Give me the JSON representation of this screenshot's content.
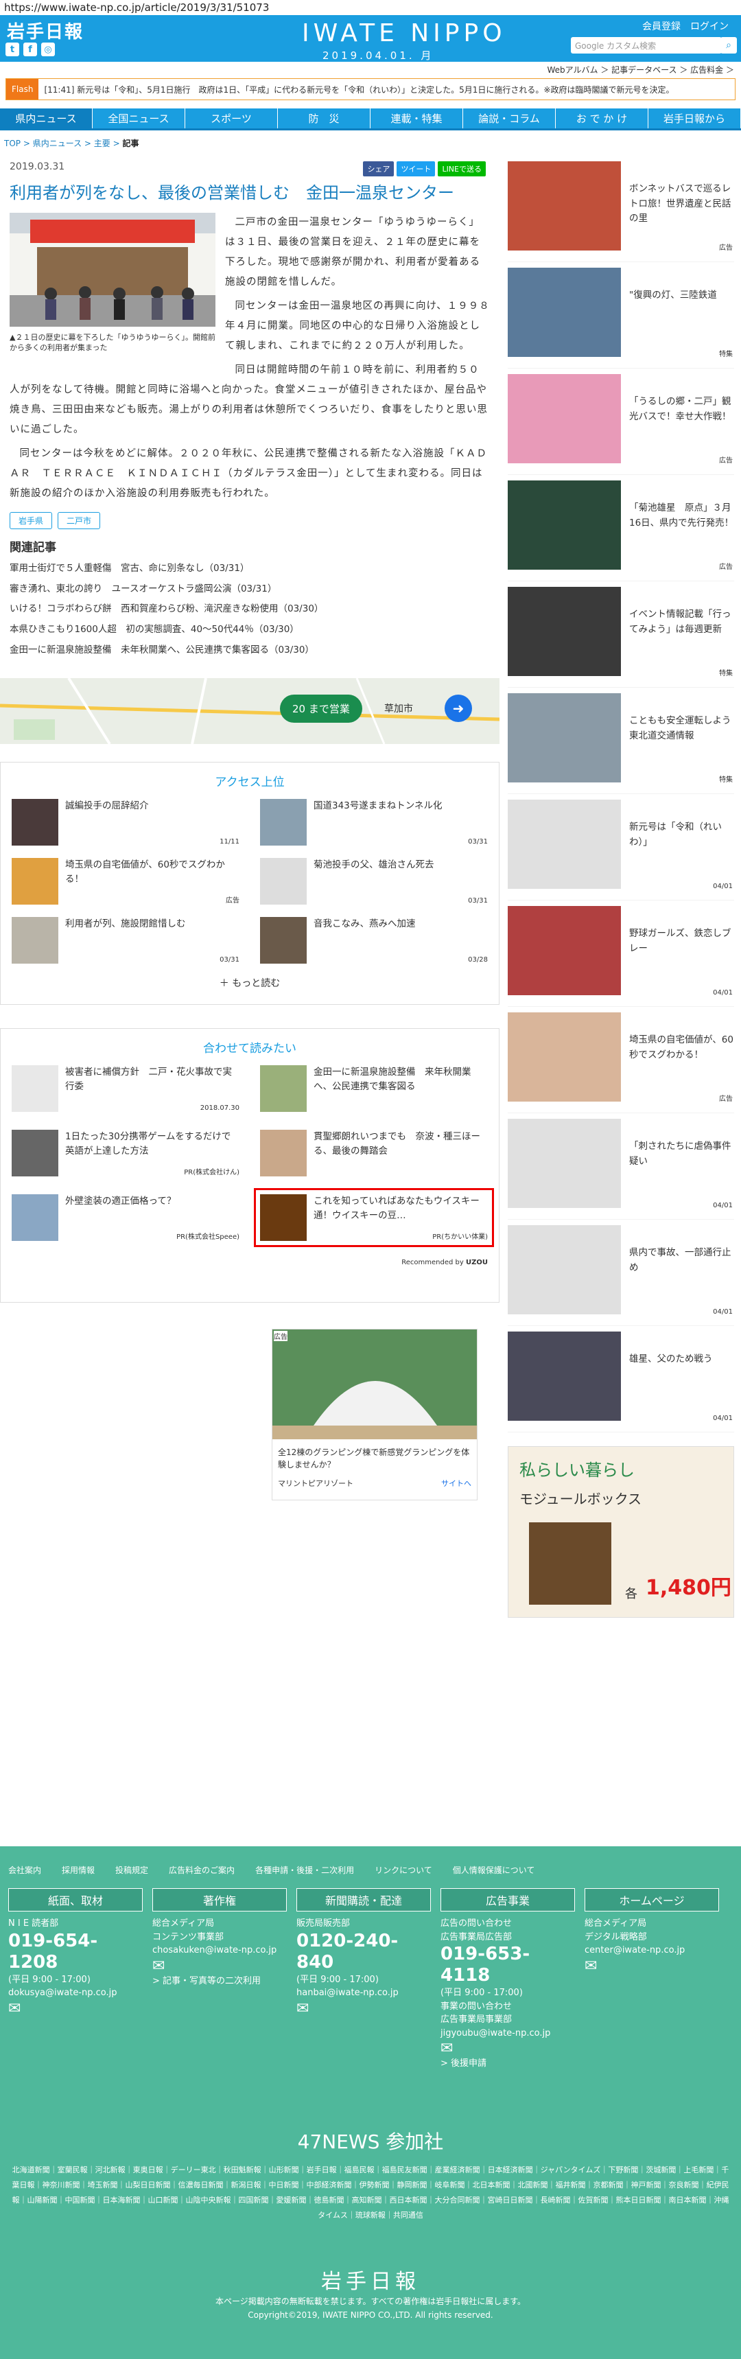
{
  "url": "https://www.iwate-np.co.jp/article/2019/3/31/51073",
  "header": {
    "logo": "岩手日報",
    "brand": "IWATE NIPPO",
    "date": "2019.04.01. 月",
    "register": "会員登録",
    "login": "ログイン",
    "search_placeholder": "Google カスタム検索"
  },
  "subnav": "Webアルバム ＞ 記事データベース ＞ 広告料金 ＞",
  "flash": {
    "label": "Flash",
    "text": "[11:41] 新元号は「令和」、5月1日施行　政府は1日、「平成」に代わる新元号を「令和（れいわ）」と決定した。5月1日に施行される。※政府は臨時閣議で新元号を決定。"
  },
  "nav": [
    "県内ニュース",
    "全国ニュース",
    "スポーツ",
    "防　災",
    "連載・特集",
    "論説・コラム",
    "お で か け",
    "岩手日報から"
  ],
  "crumb": {
    "a": "TOP",
    "b": "県内ニュース",
    "c": "主要",
    "d": "記事"
  },
  "article": {
    "date": "2019.03.31",
    "title": "利用者が列をなし、最後の営業惜しむ　金田一温泉センター",
    "share": [
      "シェア",
      "ツイート",
      "LINEで送る"
    ],
    "caption": "▲２１日の歴史に幕を下ろした「ゆうゆうゆーらく」。開館前から多くの利用者が集まった",
    "p1": "二戸市の金田一温泉センター「ゆうゆうゆーらく」は３１日、最後の営業日を迎え、２１年の歴史に幕を下ろした。現地で感謝祭が開かれ、利用者が愛着ある施設の閉館を惜しんだ。",
    "p2": "同センターは金田一温泉地区の再興に向け、１９９８年４月に開業。同地区の中心的な日帰り入浴施設として親しまれ、これまでに約２２０万人が利用した。",
    "p3": "同日は開館時間の午前１０時を前に、利用者約５０人が列をなして待機。開館と同時に浴場へと向かった。食堂メニューが値引きされたほか、屋台品や焼き鳥、三田田由来なども販売。湯上がりの利用者は休憩所でくつろいだり、食事をしたりと思い思いに過ごした。",
    "p4": "同センターは今秋をめどに解体。２０２０年秋に、公民連携で整備される新たな入浴施設「ＫＡＤＡＲ　ＴＥＲＲＡＣＥ　ＫＩＮＤＡＩＣＨＩ（カダルテラス金田一）」として生まれ変わる。同日は新施設の紹介のほか入浴施設の利用券販売も行われた。",
    "tags": [
      "岩手県",
      "二戸市"
    ],
    "related_title": "関連記事",
    "related": [
      "軍用士街灯で５人重軽傷　宮古、命に別条なし（03/31）",
      "審き湧れ、東北の誇り　ユースオーケストラ盛岡公演（03/31）",
      "いける！コラボわらび餅　西和賀産わらび粉、滝沢産きな粉使用（03/30）",
      "本県ひきこもり1600人超　初の実態調査、40～50代44％（03/30）",
      "金田一に新温泉施設整備　未年秋開業へ、公民連携で集客図る（03/30）"
    ]
  },
  "map": {
    "btn": "20 まで営業",
    "city": "草加市"
  },
  "ranking": {
    "title": "アクセス上位",
    "items": [
      {
        "t": "誠編投手の屈辞紹介",
        "d": "11/11"
      },
      {
        "t": "国道343号遂ままねトンネル化",
        "d": "03/31"
      },
      {
        "t": "埼玉県の自宅価値が、60秒でスグわかる！",
        "d": "広告"
      },
      {
        "t": "菊池投手の父、雄治さん死去",
        "d": "03/31"
      },
      {
        "t": "利用者が列、施設閉館惜しむ",
        "d": "03/31"
      },
      {
        "t": "音我こなみ、燕みへ加速",
        "d": "03/28"
      }
    ],
    "more": "もっと読む"
  },
  "reco": {
    "title": "合わせて読みたい",
    "items": [
      {
        "t": "被害者に補償方針　二戸・花火事故で実行委",
        "d": "2018.07.30"
      },
      {
        "t": "金田一に新温泉施設整備　来年秋開業へ、公民連携で集客図る",
        "d": ""
      },
      {
        "t": "1日たった30分携帯ゲームをするだけで英語が上達した方法",
        "d": "PR(株式会社けん)"
      },
      {
        "t": "貫聖郷朗れいつまでも　奈波・種三ほーる、最後の舞踏会",
        "d": ""
      },
      {
        "t": "外壁塗装の適正価格って？",
        "d": "PR(株式会社Speee)"
      },
      {
        "t": "これを知っていればあなたもウイスキー通！ウイスキーの豆…",
        "d": "PR(ちかいい体業)"
      }
    ],
    "by": "Recommended by",
    "uzou": "UZOU"
  },
  "ad": {
    "label": "広告",
    "text": "全12棟のグランピング棟で新感覚グランピングを体験しませんか？",
    "brand": "マリントピアリゾート",
    "link": "サイトへ"
  },
  "side": [
    {
      "t": "ボンネットバスで巡るレトロ旅！世界遺産と民話の里",
      "b": "広告"
    },
    {
      "t": "\"復興の灯、三陸鉄道",
      "b": "特集"
    },
    {
      "t": "「うるしの郷・二戸」観光バスで！幸せ大作戦！",
      "b": "広告"
    },
    {
      "t": "「菊池雄星　原点」３月16日、県内で先行発売！",
      "b": "広告"
    },
    {
      "t": "イベント情報記載「行ってみよう」は毎週更新",
      "b": "特集"
    },
    {
      "t": "こともも安全運転しよう　東北道交通情報",
      "b": "特集"
    },
    {
      "t": "新元号は「令和（れいわ）」",
      "b": "04/01"
    },
    {
      "t": "野球ガールズ、鉄恋しブレー",
      "b": "04/01"
    },
    {
      "t": "埼玉県の自宅価値が、60秒でスグわかる！",
      "b": "広告"
    },
    {
      "t": "「刺されたちに虐偽事件疑い",
      "b": "04/01"
    },
    {
      "t": "県内で事故、一部通行止め",
      "b": "04/01"
    },
    {
      "t": "雄星、父のため戦う",
      "b": "04/01"
    }
  ],
  "side_ad": {
    "a": "私らしい暮らし",
    "b": "モジュールボックス",
    "c": "1,480円",
    "d": "各"
  },
  "footer": {
    "links": [
      "会社案内",
      "採用情報",
      "投稿規定",
      "広告料金のご案内",
      "各種申請・後援・二次利用",
      "リンクについて",
      "個人情報保護について"
    ],
    "cols": [
      {
        "h": "紙面、取材",
        "p1": "N I E 読者部",
        "tel": "019-654-1208",
        "p2": "(平日 9:00 - 17:00)",
        "p3": "dokusya@iwate-np.co.jp",
        "p4": ""
      },
      {
        "h": "著作権",
        "p1": "総合メディア局\nコンテンツ事業部",
        "tel": "",
        "p2": "chosakuken@iwate-np.co.jp",
        "p3": "",
        "p4": "> 記事・写真等の二次利用"
      },
      {
        "h": "新聞購読・配達",
        "p1": "販売局販売部",
        "tel": "0120-240-840",
        "p2": "(平日 9:00 - 17:00)",
        "p3": "hanbai@iwate-np.co.jp",
        "p4": ""
      },
      {
        "h": "広告事業",
        "p1": "広告の問い合わせ\n広告事業局広告部",
        "tel": "019-653-4118",
        "p2": "(平日 9:00 - 17:00)",
        "p3": "事業の問い合わせ\n広告事業局事業部\njigyoubu@iwate-np.co.jp",
        "p4": "> 後援申請"
      },
      {
        "h": "ホームページ",
        "p1": "総合メディア局\nデジタル戦略部",
        "tel": "",
        "p2": "center@iwate-np.co.jp",
        "p3": "",
        "p4": ""
      }
    ],
    "n47": "47NEWS 参加社",
    "nlist": "北海道新聞｜室蘭民報｜河北新報｜東奥日報｜デーリー東北｜秋田魁新報｜山形新聞｜岩手日報｜福島民報｜福島民友新聞｜産業経済新聞｜日本経済新聞｜ジャパンタイムズ｜下野新聞｜茨城新聞｜上毛新聞｜千葉日報｜神奈川新聞｜埼玉新聞｜山梨日日新聞｜信濃毎日新聞｜新潟日報｜中日新聞｜中部経済新聞｜伊勢新聞｜静岡新聞｜岐阜新聞｜北日本新聞｜北國新聞｜福井新聞｜京都新聞｜神戸新聞｜奈良新聞｜紀伊民報｜山陽新聞｜中国新聞｜日本海新聞｜山口新聞｜山陰中央新報｜四国新聞｜愛媛新聞｜徳島新聞｜高知新聞｜西日本新聞｜大分合同新聞｜宮崎日日新聞｜長崎新聞｜佐賀新聞｜熊本日日新聞｜南日本新聞｜沖縄タイムス｜琉球新報｜共同通信",
    "logo": "岩手日報",
    "c1": "本ページ掲載内容の無断転載を禁じます。すべての著作権は岩手日報社に属します。",
    "c2": "Copyright©2019, IWATE NIPPO CO.,LTD. All rights reserved."
  }
}
